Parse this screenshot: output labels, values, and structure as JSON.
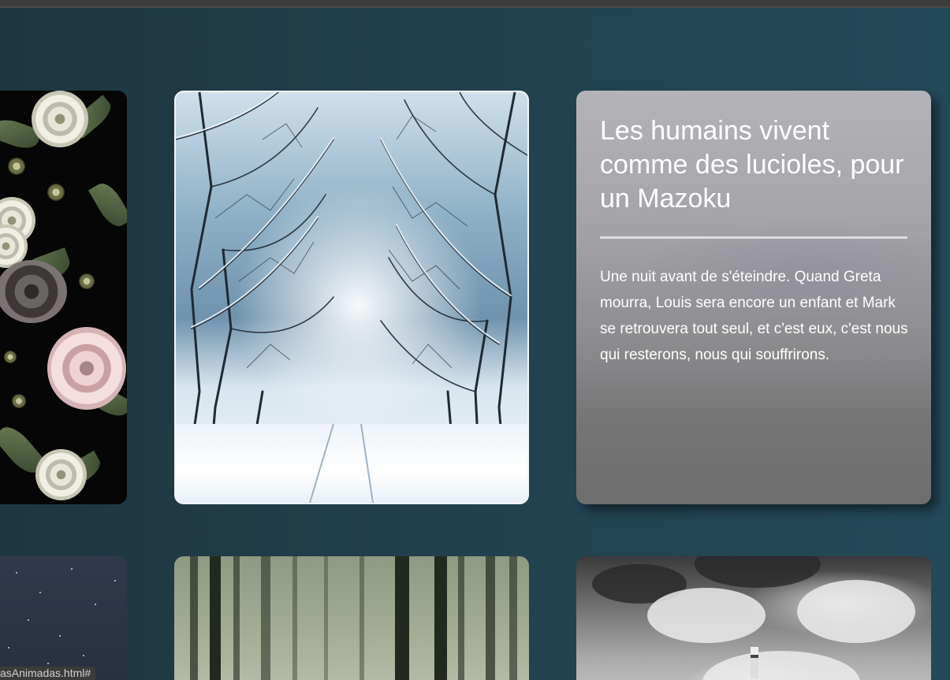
{
  "quote_card": {
    "title": "Les humains vivent comme des lucioles, pour un Mazoku",
    "text": "Une nuit avant de s'éteindre. Quand Greta mourra, Louis sera encore un enfant et Mark se retrouvera tout seul, et c'est eux, c'est nous qui resterons, nous qui souffrirons."
  },
  "status_bar": {
    "link_text": "asAnimadas.html#"
  },
  "icons": {
    "flowers": "floral-image",
    "winter": "snowy-forest-image",
    "stars": "starry-sky-image",
    "forest": "misty-forest-image",
    "storm": "stormy-lighthouse-image"
  }
}
